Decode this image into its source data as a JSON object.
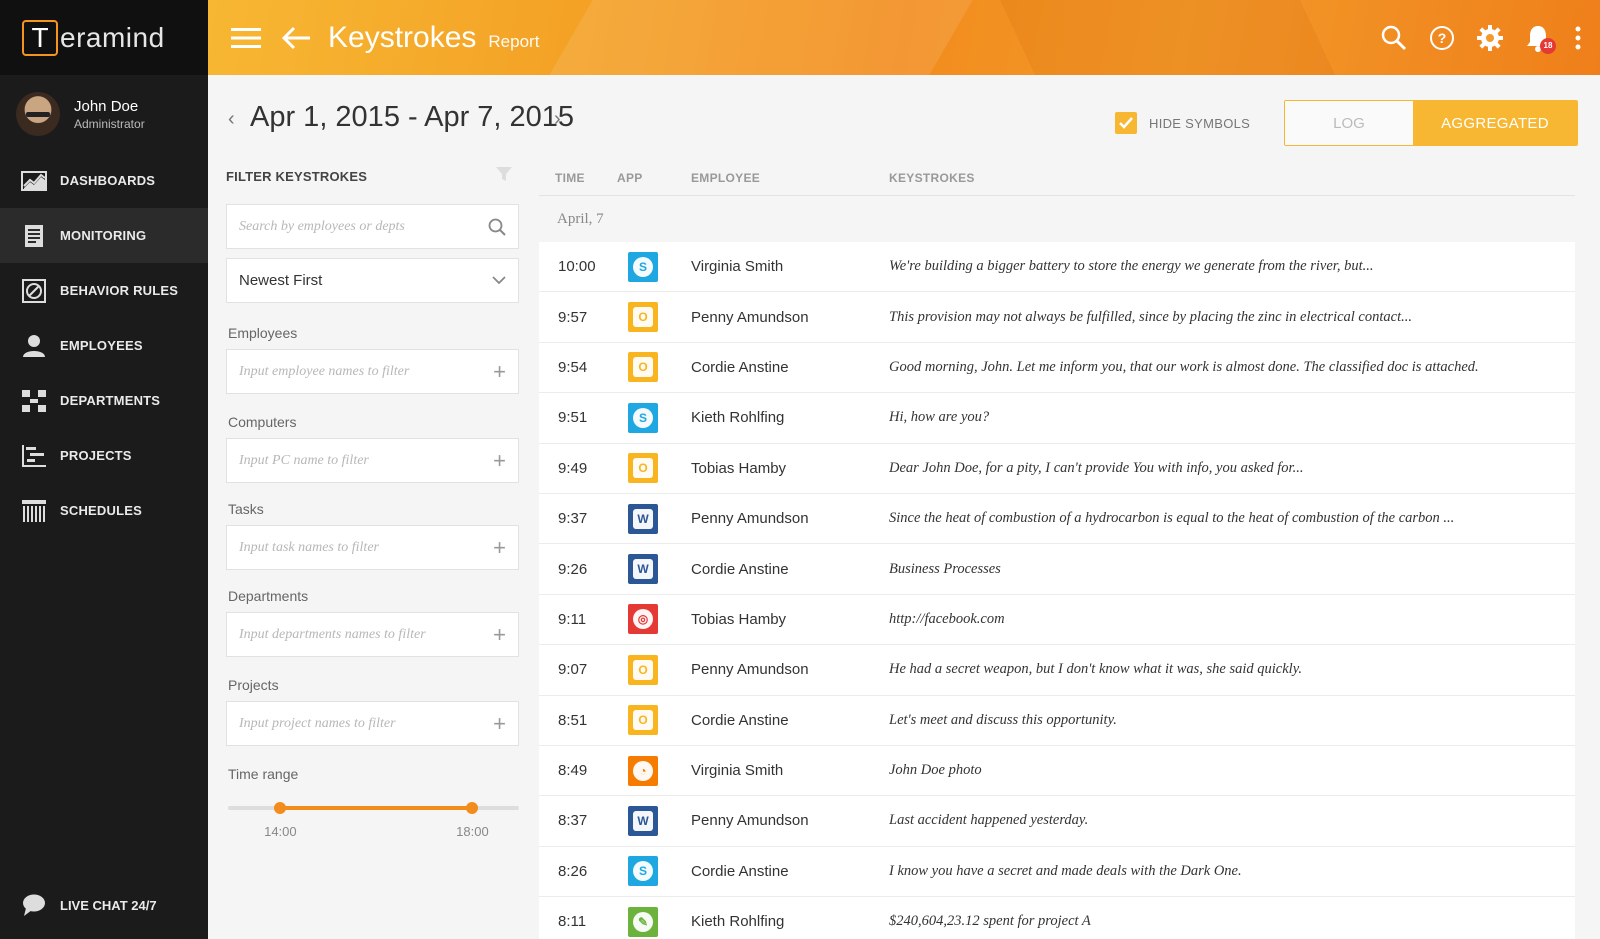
{
  "brand": {
    "logo_letter": "T",
    "logo_text": "eramind"
  },
  "user": {
    "name": "John Doe",
    "role": "Administrator"
  },
  "nav": [
    {
      "label": "DASHBOARDS",
      "icon": "chart-icon"
    },
    {
      "label": "MONITORING",
      "icon": "document-icon",
      "active": true
    },
    {
      "label": "BEHAVIOR RULES",
      "icon": "no-entry-icon"
    },
    {
      "label": "EMPLOYEES",
      "icon": "person-icon"
    },
    {
      "label": "DEPARTMENTS",
      "icon": "org-chart-icon"
    },
    {
      "label": "PROJECTS",
      "icon": "gantt-icon"
    },
    {
      "label": "SCHEDULES",
      "icon": "calendar-grid-icon"
    }
  ],
  "live_chat": "LIVE CHAT 24/7",
  "header": {
    "title": "Keystrokes",
    "subtitle": "Report",
    "notification_count": "18"
  },
  "date_range": "Apr 1, 2015 - Apr 7, 2015",
  "hide_symbols": {
    "label": "HIDE SYMBOLS",
    "checked": true
  },
  "view_toggle": {
    "log": "LOG",
    "aggregated": "AGGREGATED",
    "selected": "AGGREGATED"
  },
  "filter": {
    "title": "FILTER KEYSTROKES",
    "search_placeholder": "Search by employees or depts",
    "sort": "Newest First",
    "employees_label": "Employees",
    "employees_placeholder": "Input employee names to filter",
    "computers_label": "Computers",
    "computers_placeholder": "Input PC name to filter",
    "tasks_label": "Tasks",
    "tasks_placeholder": "Input task names to filter",
    "departments_label": "Departments",
    "departments_placeholder": "Input departments names to filter",
    "projects_label": "Projects",
    "projects_placeholder": "Input project names to filter",
    "time_range_label": "Time range",
    "time_range": {
      "min": "14:00",
      "max": "18:00",
      "low_fraction": 0.18,
      "high_fraction": 0.84
    }
  },
  "table": {
    "columns": [
      "TIME",
      "APP",
      "EMPLOYEE",
      "KEYSTROKES"
    ],
    "group": "April, 7",
    "rows": [
      {
        "time": "10:00",
        "app": "skype",
        "employee": "Virginia Smith",
        "keystrokes": "We're building a bigger battery to store the energy we generate from the river, but..."
      },
      {
        "time": "9:57",
        "app": "outlook",
        "employee": "Penny Amundson",
        "keystrokes": "This provision may not always be fulfilled, since by placing the zinc in electrical contact..."
      },
      {
        "time": "9:54",
        "app": "outlook",
        "employee": "Cordie Anstine",
        "keystrokes": "Good morning, John. Let me inform you, that our work is almost done. The classified doc is attached."
      },
      {
        "time": "9:51",
        "app": "skype",
        "employee": "Kieth Rohlfing",
        "keystrokes": "Hi, how are you?"
      },
      {
        "time": "9:49",
        "app": "outlook",
        "employee": "Tobias Hamby",
        "keystrokes": "Dear John Doe, for a pity, I can't provide You with info, you asked for..."
      },
      {
        "time": "9:37",
        "app": "word",
        "employee": "Penny Amundson",
        "keystrokes": "Since the heat of combustion of a hydrocarbon is equal to the heat of combustion of the carbon ..."
      },
      {
        "time": "9:26",
        "app": "word",
        "employee": "Cordie Anstine",
        "keystrokes": "Business Processes"
      },
      {
        "time": "9:11",
        "app": "chrome",
        "employee": "Tobias Hamby",
        "keystrokes": "http://facebook.com"
      },
      {
        "time": "9:07",
        "app": "outlook",
        "employee": "Penny Amundson",
        "keystrokes": "He had a secret weapon, but I don't know what it was, she said quickly."
      },
      {
        "time": "8:51",
        "app": "outlook",
        "employee": "Cordie Anstine",
        "keystrokes": "Let's meet and discuss this opportunity."
      },
      {
        "time": "8:49",
        "app": "firefox",
        "employee": "Virginia Smith",
        "keystrokes": "John Doe photo"
      },
      {
        "time": "8:37",
        "app": "word",
        "employee": "Penny Amundson",
        "keystrokes": "Last accident happened yesterday."
      },
      {
        "time": "8:26",
        "app": "skype",
        "employee": "Cordie Anstine",
        "keystrokes": "I know you have a secret and made deals with the Dark One."
      },
      {
        "time": "8:11",
        "app": "evernote",
        "employee": "Kieth Rohlfing",
        "keystrokes": "$240,604,23.12 spent for project A"
      }
    ]
  },
  "app_icons": {
    "skype": {
      "color": "#1ea7e1",
      "glyph": "S",
      "fg": "#1ea7e1"
    },
    "outlook": {
      "color": "#f9b520",
      "glyph": "O",
      "fg": "#f9b520"
    },
    "word": {
      "color": "#2b5797",
      "glyph": "W",
      "fg": "#2b5797"
    },
    "chrome": {
      "color": "#e53935",
      "glyph": "◎",
      "fg": "#e53935"
    },
    "firefox": {
      "color": "#f57c00",
      "glyph": "◔",
      "fg": "#f57c00"
    },
    "evernote": {
      "color": "#6cb33e",
      "glyph": "✎",
      "fg": "#6cb33e"
    }
  },
  "colors": {
    "accent": "#f7b733",
    "accent_dark": "#f28c1d",
    "sidebar": "#1b1b1b"
  }
}
